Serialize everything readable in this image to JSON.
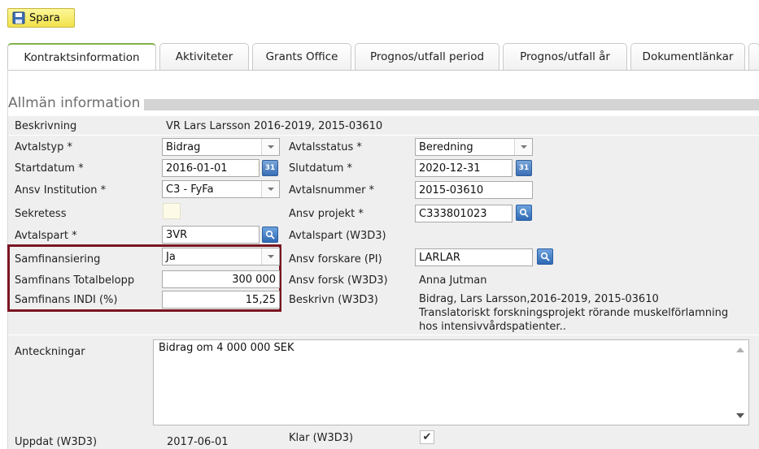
{
  "toolbar": {
    "save_label": "Spara"
  },
  "tabs": [
    {
      "label": "Kontraktsinformation",
      "active": true
    },
    {
      "label": "Aktiviteter"
    },
    {
      "label": "Grants Office"
    },
    {
      "label": "Prognos/utfall period"
    },
    {
      "label": "Prognos/utfall år"
    },
    {
      "label": "Dokumentlänkar"
    }
  ],
  "section": {
    "title": "Allmän information"
  },
  "form": {
    "beskrivning": {
      "label": "Beskrivning",
      "value": "VR Lars Larsson 2016-2019, 2015-03610"
    },
    "avtalstyp": {
      "label": "Avtalstyp *",
      "value": "Bidrag"
    },
    "avtalsstatus": {
      "label": "Avtalsstatus *",
      "value": "Beredning"
    },
    "startdatum": {
      "label": "Startdatum *",
      "value": "2016-01-01"
    },
    "slutdatum": {
      "label": "Slutdatum *",
      "value": "2020-12-31"
    },
    "ansv_institution": {
      "label": "Ansv Institution *",
      "value": "C3 - FyFa"
    },
    "avtalsnummer": {
      "label": "Avtalsnummer *",
      "value": "2015-03610"
    },
    "sekretess": {
      "label": "Sekretess"
    },
    "ansv_projekt": {
      "label": "Ansv projekt *",
      "value": "C333801023"
    },
    "avtalspart": {
      "label": "Avtalspart *",
      "value": "3VR"
    },
    "avtalspart_w3d3": {
      "label": "Avtalspart (W3D3)"
    },
    "samfinansiering": {
      "label": "Samfinansiering",
      "value": "Ja"
    },
    "ansv_forskare": {
      "label": "Ansv forskare (PI)",
      "value": "LARLAR"
    },
    "samfinans_totalbelopp": {
      "label": "Samfinans Totalbelopp",
      "value": "300 000"
    },
    "ansv_forsk_w3d3": {
      "label": "Ansv forsk (W3D3)",
      "value": "Anna Jutman"
    },
    "samfinans_indi": {
      "label": "Samfinans INDI (%)",
      "value": "15,25"
    },
    "beskrivn_w3d3": {
      "label": "Beskrivn (W3D3)",
      "line1": "Bidrag, Lars Larsson,2016-2019, 2015-03610",
      "line2": "Translatoriskt forskningsprojekt rörande muskelförlamning",
      "line3": "hos intensivvårdspatienter.."
    },
    "anteckningar": {
      "label": "Anteckningar",
      "value": "Bidrag om 4 000 000 SEK"
    },
    "uppdat_w3d3": {
      "label": "Uppdat (W3D3)",
      "value": "2017-06-01"
    },
    "klar_w3d3": {
      "label": "Klar (W3D3)",
      "checked": true,
      "mark": "✔"
    }
  },
  "colors": {
    "save_bg": "#f2e24a",
    "tab_active_accent": "#7fb24a",
    "highlight_border": "#7a1522",
    "panel_bg": "#efefef"
  },
  "icons": [
    "save-icon",
    "calendar-icon",
    "search-icon",
    "dropdown-arrow-icon",
    "check-icon"
  ]
}
